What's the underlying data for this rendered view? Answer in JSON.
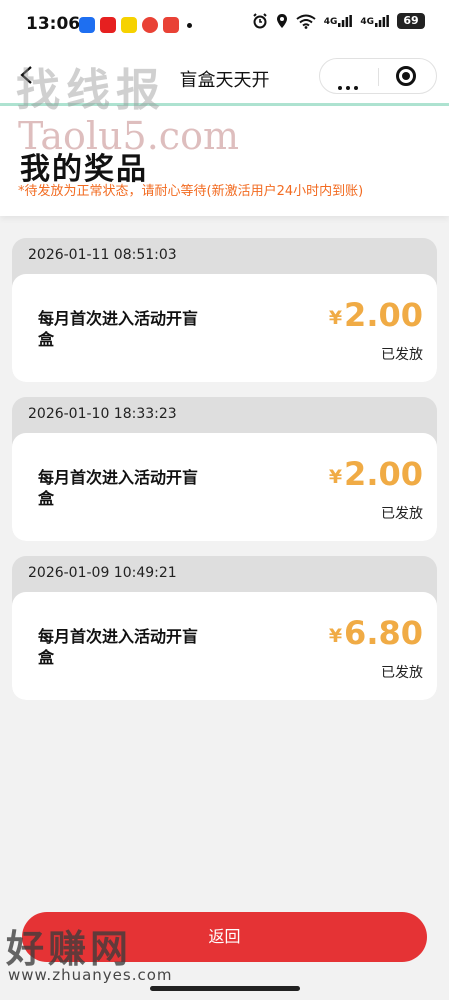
{
  "status_bar": {
    "time": "13:06",
    "network_1": "4G",
    "network_2": "4G",
    "battery": "69",
    "app_icon_colors": [
      "#1e6ff1",
      "#e62020",
      "#f6d200",
      "#e94236",
      "#e94236"
    ]
  },
  "nav": {
    "title": "盲盒天天开",
    "back_icon": "chevron-left-icon",
    "more_icon": "more-dots-icon",
    "close_icon": "target-circle-icon"
  },
  "header": {
    "title": "我的奖品",
    "notice": "*待发放为正常状态，请耐心等待(新激活用户24小时内到账)"
  },
  "prizes": [
    {
      "date": "2026-01-11 08:51:03",
      "name": "每月首次进入活动开盲盒",
      "currency": "¥",
      "amount": "2.00",
      "status": "已发放"
    },
    {
      "date": "2026-01-10 18:33:23",
      "name": "每月首次进入活动开盲盒",
      "currency": "¥",
      "amount": "2.00",
      "status": "已发放"
    },
    {
      "date": "2026-01-09 10:49:21",
      "name": "每月首次进入活动开盲盒",
      "currency": "¥",
      "amount": "6.80",
      "status": "已发放"
    }
  ],
  "footer": {
    "return_label": "返回"
  },
  "watermarks": {
    "top_cn": "找线报",
    "top_en": "Taolu5.com",
    "bottom_cn": "好赚网",
    "bottom_en": "www.zhuanyes.com"
  },
  "colors": {
    "accent_line": "#aee3d1",
    "notice": "#f26b21",
    "amount": "#f0ab45",
    "return_button": "#e53335"
  }
}
